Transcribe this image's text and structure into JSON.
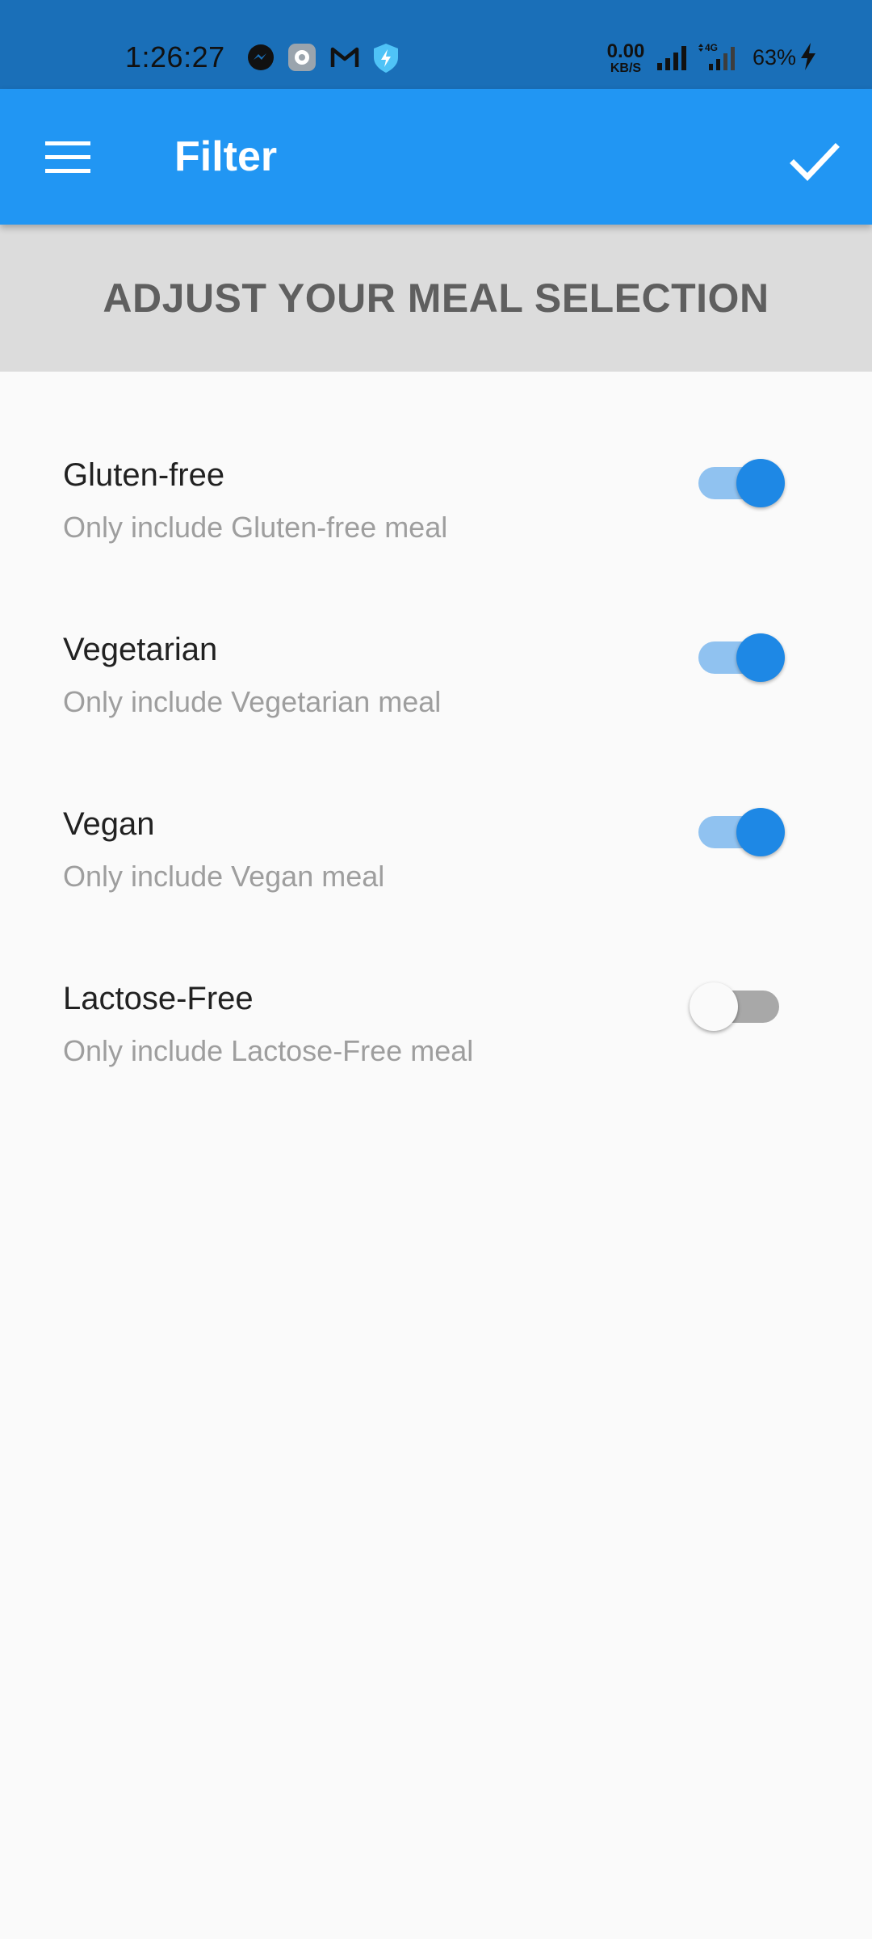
{
  "status_bar": {
    "time": "1:26:27",
    "net_speed_value": "0.00",
    "net_speed_unit": "KB/S",
    "network_type": "4G",
    "battery": "63%",
    "icons": [
      "messenger-icon",
      "settings-app-icon",
      "gmail-icon",
      "shield-bolt-icon",
      "signal-icon",
      "signal-4g-icon",
      "charging-icon"
    ]
  },
  "app_bar": {
    "title": "Filter",
    "menu_icon": "menu-icon",
    "save_icon": "check-icon",
    "color": "#2196f3"
  },
  "banner": {
    "text": "ADJUST YOUR MEAL SELECTION"
  },
  "filters": [
    {
      "title": "Gluten-free",
      "subtitle": "Only include Gluten-free meal",
      "enabled": true
    },
    {
      "title": "Vegetarian",
      "subtitle": "Only include Vegetarian meal",
      "enabled": true
    },
    {
      "title": "Vegan",
      "subtitle": "Only include Vegan meal",
      "enabled": true
    },
    {
      "title": "Lactose-Free",
      "subtitle": "Only include Lactose-Free meal",
      "enabled": false
    }
  ],
  "colors": {
    "accent": "#1e88e5",
    "accent_light": "#90c2f0",
    "status_bar": "#1a6fb8"
  }
}
